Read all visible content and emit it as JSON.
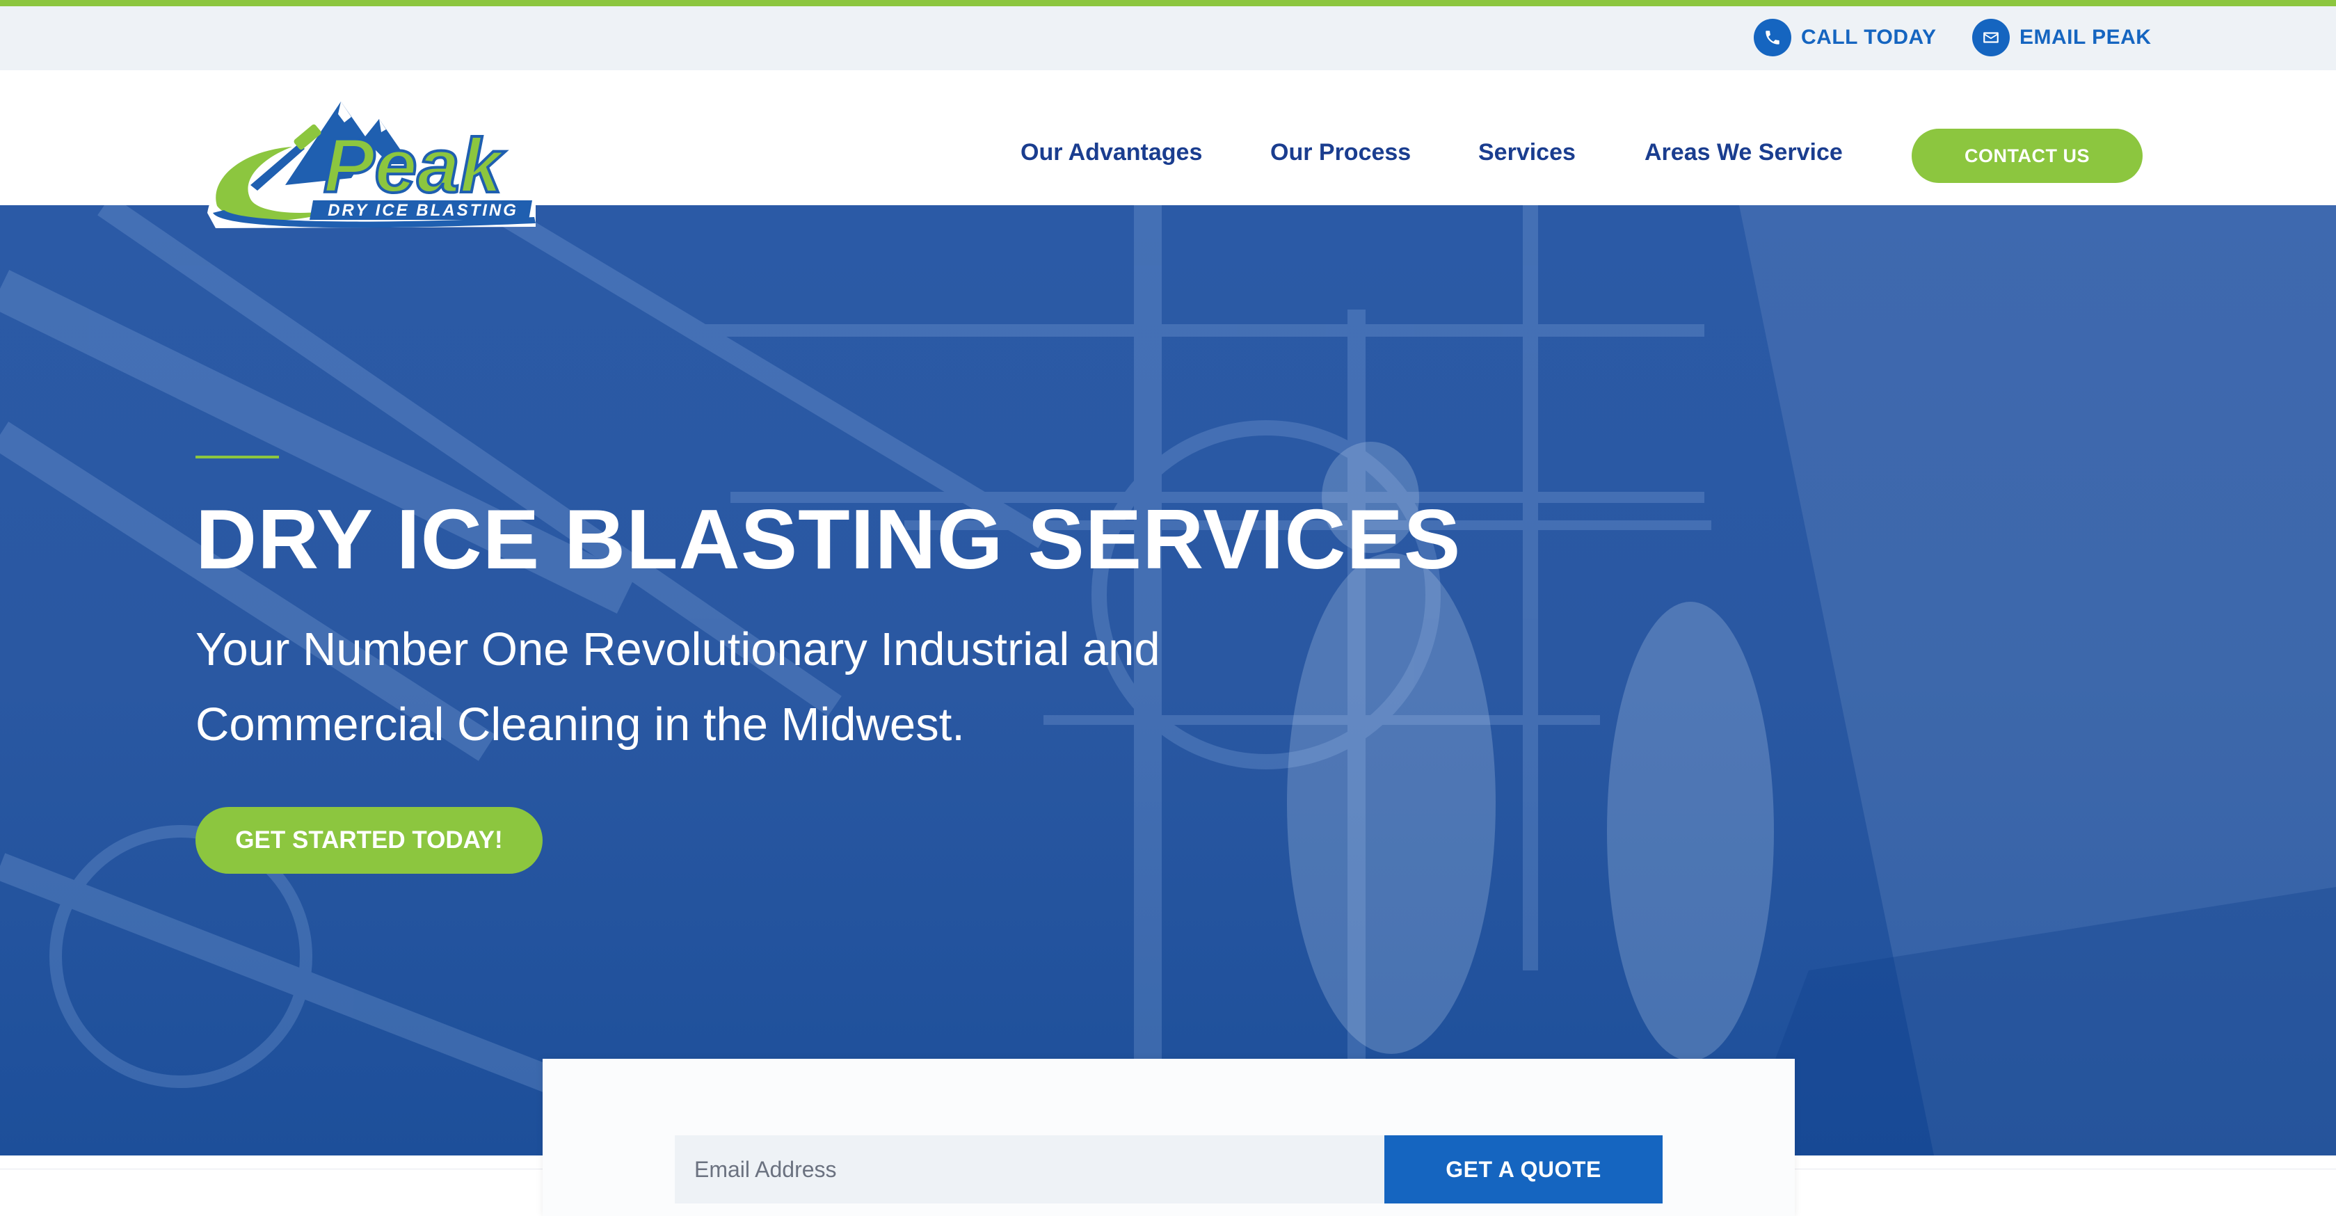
{
  "topbar": {
    "call_label": "CALL TODAY",
    "call_icon": "phone-icon",
    "email_label": "EMAIL PEAK",
    "email_icon": "envelope-icon"
  },
  "logo": {
    "wordmark": "Peak",
    "tagline": "DRY ICE BLASTING"
  },
  "nav": {
    "items": [
      {
        "label": "Our Advantages"
      },
      {
        "label": "Our Process"
      },
      {
        "label": "Services"
      },
      {
        "label": "Areas We Service"
      }
    ],
    "contact_label": "CONTACT US"
  },
  "hero": {
    "title": "DRY ICE BLASTING SERVICES",
    "subtitle_line1": "Your Number One Revolutionary Industrial and",
    "subtitle_line2": "Commercial Cleaning in the Midwest.",
    "cta_label": "GET STARTED TODAY!"
  },
  "quote_form": {
    "email_placeholder": "Email Address",
    "submit_label": "GET A QUOTE"
  },
  "colors": {
    "brand_green": "#8cc63f",
    "brand_blue": "#1565c0",
    "nav_text": "#1a3d8f",
    "hero_overlay": "#2b5aa6"
  }
}
